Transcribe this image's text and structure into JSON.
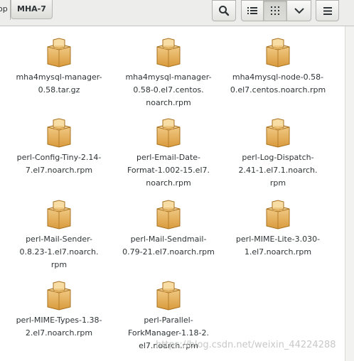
{
  "breadcrumb": {
    "previous": "op",
    "current": "MHA-7"
  },
  "toolbar": {
    "search_icon": "search-icon",
    "list_icon": "list-view-icon",
    "grid_icon": "grid-view-icon",
    "sort_icon": "chevron-down-icon",
    "menu_icon": "hamburger-menu-icon",
    "grid_view_active": true
  },
  "files": [
    {
      "label": "mha4mysql-manager-\n0.58.tar.gz",
      "icon": "package-icon"
    },
    {
      "label": "mha4mysql-manager-\n0.58-0.el7.centos.\nnoarch.rpm",
      "icon": "package-icon"
    },
    {
      "label": "mha4mysql-node-0.58-\n0.el7.centos.noarch.rpm",
      "icon": "package-icon"
    },
    {
      "label": "perl-Config-Tiny-2.14-\n7.el7.noarch.rpm",
      "icon": "package-icon"
    },
    {
      "label": "perl-Email-Date-\nFormat-1.002-15.el7.\nnoarch.rpm",
      "icon": "package-icon"
    },
    {
      "label": "perl-Log-Dispatch-\n2.41-1.el7.1.noarch.\nrpm",
      "icon": "package-icon"
    },
    {
      "label": "perl-Mail-Sender-\n0.8.23-1.el7.noarch.\nrpm",
      "icon": "package-icon"
    },
    {
      "label": "perl-Mail-Sendmail-\n0.79-21.el7.noarch.rpm",
      "icon": "package-icon"
    },
    {
      "label": "perl-MIME-Lite-3.030-\n1.el7.noarch.rpm",
      "icon": "package-icon"
    },
    {
      "label": "perl-MIME-Types-1.38-\n2.el7.noarch.rpm",
      "icon": "package-icon"
    },
    {
      "label": "perl-Parallel-\nForkManager-1.18-2.\nel7.noarch.rpm",
      "icon": "package-icon"
    }
  ],
  "watermark": "https://blog.csdn.net/weixin_44224288"
}
